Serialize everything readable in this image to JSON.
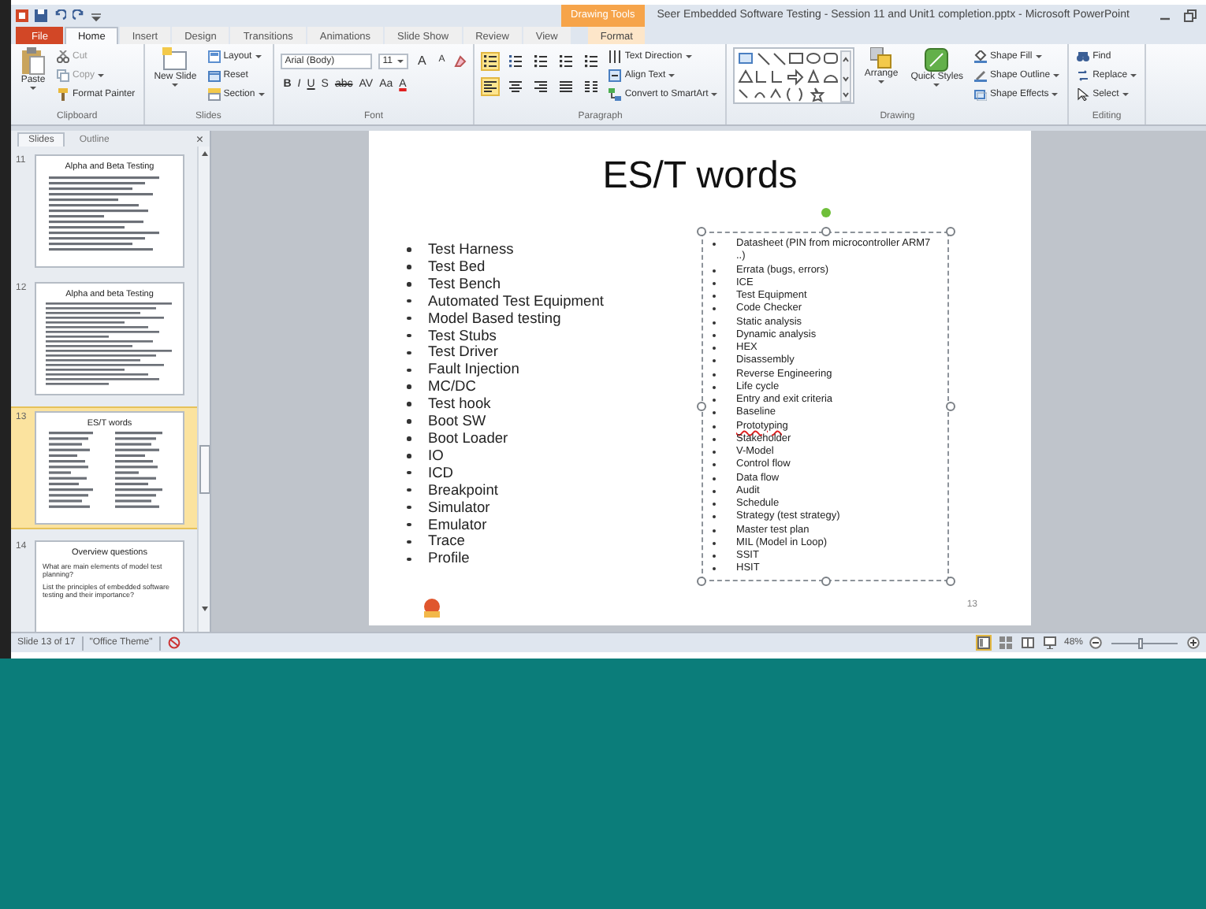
{
  "window": {
    "title": "Seer Embedded Software Testing - Session 11 and Unit1 completion.pptx - Microsoft PowerPoint",
    "context_tab": "Drawing Tools"
  },
  "tabs": [
    {
      "label": "File",
      "kind": "file",
      "selected": false
    },
    {
      "label": "Home",
      "kind": "normal",
      "selected": true
    },
    {
      "label": "Insert",
      "kind": "normal",
      "selected": false
    },
    {
      "label": "Design",
      "kind": "normal",
      "selected": false
    },
    {
      "label": "Transitions",
      "kind": "normal",
      "selected": false
    },
    {
      "label": "Animations",
      "kind": "normal",
      "selected": false
    },
    {
      "label": "Slide Show",
      "kind": "normal",
      "selected": false
    },
    {
      "label": "Review",
      "kind": "normal",
      "selected": false
    },
    {
      "label": "View",
      "kind": "normal",
      "selected": false
    },
    {
      "label": "Format",
      "kind": "context",
      "selected": false
    }
  ],
  "ribbon": [
    {
      "label": "Clipboard",
      "columns": [
        {
          "kind": "paste",
          "label": "Paste",
          "dropdown": true
        },
        {
          "kind": "stack",
          "items": [
            {
              "label": "Cut",
              "kind": "cut",
              "disabled": true,
              "dropdown": false
            },
            {
              "label": "Copy",
              "kind": "copy",
              "disabled": true,
              "dropdown": true
            },
            {
              "label": "Format Painter",
              "kind": "painter",
              "disabled": false,
              "dropdown": false
            }
          ]
        }
      ]
    },
    {
      "label": "Slides",
      "columns": [
        {
          "kind": "newslide",
          "label": "New Slide",
          "dropdown": true
        },
        {
          "kind": "stack",
          "items": [
            {
              "label": "Layout",
              "kind": "layout",
              "disabled": false,
              "dropdown": true
            },
            {
              "label": "Reset",
              "kind": "reset",
              "disabled": false,
              "dropdown": false
            },
            {
              "label": "Section",
              "kind": "section",
              "disabled": false,
              "dropdown": true
            }
          ]
        }
      ]
    },
    {
      "label": "Font",
      "columns": [
        {
          "kind": "font",
          "font": "Arial (Body)",
          "size": "11",
          "grow": "A",
          "shrink": "A",
          "styles": [
            "B",
            "I",
            "U",
            "S",
            "abc",
            "AV",
            "Aa",
            "A"
          ]
        }
      ]
    },
    {
      "label": "Paragraph",
      "columns": [
        {
          "kind": "tools",
          "rows": [
            [
              {
                "kind": "bullets",
                "selected": true
              },
              {
                "kind": "numbering",
                "selected": false
              },
              {
                "kind": "outdent",
                "selected": false
              },
              {
                "kind": "indent",
                "selected": false
              },
              {
                "kind": "spacing",
                "selected": false
              }
            ],
            [
              {
                "kind": "left",
                "selected": true
              },
              {
                "kind": "center",
                "selected": false
              },
              {
                "kind": "right",
                "selected": false
              },
              {
                "kind": "justify",
                "selected": false
              },
              {
                "kind": "columns",
                "selected": false
              }
            ]
          ]
        },
        {
          "kind": "stack",
          "items": [
            {
              "label": "Text Direction",
              "kind": "textdir",
              "disabled": false,
              "dropdown": true
            },
            {
              "label": "Align Text",
              "kind": "align",
              "disabled": false,
              "dropdown": true
            },
            {
              "label": "Convert to SmartArt",
              "kind": "smartart",
              "disabled": false,
              "dropdown": true
            }
          ]
        }
      ]
    },
    {
      "label": "Drawing",
      "columns": [
        {
          "kind": "gallery"
        },
        {
          "kind": "arrange",
          "label": "Arrange",
          "dropdown": true
        },
        {
          "kind": "quick",
          "label": "Quick Styles",
          "dropdown": true
        },
        {
          "kind": "stack",
          "items": [
            {
              "label": "Shape Fill",
              "kind": "fill",
              "disabled": false,
              "dropdown": true
            },
            {
              "label": "Shape Outline",
              "kind": "outline",
              "disabled": false,
              "dropdown": true
            },
            {
              "label": "Shape Effects",
              "kind": "effects",
              "disabled": false,
              "dropdown": true
            }
          ]
        }
      ]
    },
    {
      "label": "Editing",
      "columns": [
        {
          "kind": "stack",
          "items": [
            {
              "label": "Find",
              "kind": "find",
              "disabled": false,
              "dropdown": false
            },
            {
              "label": "Replace",
              "kind": "replace",
              "disabled": false,
              "dropdown": true
            },
            {
              "label": "Select",
              "kind": "select",
              "disabled": false,
              "dropdown": true
            }
          ]
        }
      ]
    }
  ],
  "pane": {
    "tabs": [
      {
        "label": "Slides",
        "selected": true
      },
      {
        "label": "Outline",
        "selected": false
      }
    ],
    "close": "×",
    "thumbnails": [
      {
        "number": "11",
        "title": "Alpha and Beta Testing",
        "kind": "bullets",
        "selected": false
      },
      {
        "number": "12",
        "title": "Alpha and beta Testing",
        "kind": "dense",
        "selected": false
      },
      {
        "number": "13",
        "title": "ES/T words",
        "kind": "two_column",
        "selected": true
      },
      {
        "number": "14",
        "title": "Overview questions",
        "kind": "text",
        "selected": false,
        "bullets": [
          "What are main elements of model test planning?",
          "List the principles of embedded software testing and their importance?"
        ]
      }
    ]
  },
  "slide": {
    "title": "ES/T words",
    "number": "13",
    "left_list": [
      "Test Harness",
      "Test Bed",
      "Test Bench",
      "Automated Test Equipment",
      "Model Based testing",
      "Test Stubs",
      "Test Driver",
      "Fault Injection",
      "MC/DC",
      "Test hook",
      "Boot SW",
      "Boot Loader",
      "IO",
      "ICD",
      "Breakpoint",
      "Simulator",
      "Emulator",
      "Trace",
      "Profile"
    ],
    "right_list": [
      {
        "text": "Datasheet (PIN from microcontroller ARM7 ..)",
        "spelling_error": false
      },
      {
        "text": "Errata (bugs, errors)",
        "spelling_error": false
      },
      {
        "text": "ICE",
        "spelling_error": false
      },
      {
        "text": "Test Equipment",
        "spelling_error": false
      },
      {
        "text": "Code Checker",
        "spelling_error": false
      },
      {
        "text": "Static analysis",
        "spelling_error": false
      },
      {
        "text": "Dynamic analysis",
        "spelling_error": false
      },
      {
        "text": "HEX",
        "spelling_error": false
      },
      {
        "text": "Disassembly",
        "spelling_error": false
      },
      {
        "text": "Reverse Engineering",
        "spelling_error": false
      },
      {
        "text": "Life cycle",
        "spelling_error": false
      },
      {
        "text": "Entry and exit criteria",
        "spelling_error": false
      },
      {
        "text": "Baseline",
        "spelling_error": false
      },
      {
        "text": "Prototyping",
        "spelling_error": true
      },
      {
        "text": "Stakeholder",
        "spelling_error": false
      },
      {
        "text": "V-Model",
        "spelling_error": false
      },
      {
        "text": "Control flow",
        "spelling_error": false
      },
      {
        "text": "Data flow",
        "spelling_error": false
      },
      {
        "text": "Audit",
        "spelling_error": false
      },
      {
        "text": "Schedule",
        "spelling_error": false
      },
      {
        "text": "Strategy (test strategy)",
        "spelling_error": false
      },
      {
        "text": "Master test plan",
        "spelling_error": false
      },
      {
        "text": "MIL (Model in Loop)",
        "spelling_error": false
      },
      {
        "text": "SSIT",
        "spelling_error": false
      },
      {
        "text": "HSIT",
        "spelling_error": false
      }
    ],
    "textbox_selected": true
  },
  "status_bar": {
    "slide": "Slide 13 of 17",
    "theme": "\"Office Theme\"",
    "views": [
      {
        "kind": "normal",
        "selected": true
      },
      {
        "kind": "sorter",
        "selected": false
      },
      {
        "kind": "reading",
        "selected": false
      },
      {
        "kind": "show",
        "selected": false
      }
    ],
    "zoom": "48%",
    "zoom_slider": {
      "level": 0.45
    }
  }
}
